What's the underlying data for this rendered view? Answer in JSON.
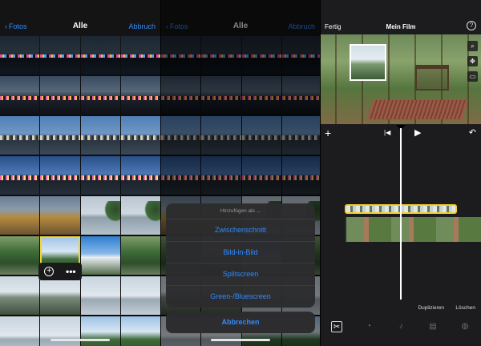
{
  "photos_panel": {
    "back_label": "Fotos",
    "title": "Alle",
    "cancel_label": "Abbruch",
    "rows": [
      [
        "night",
        "night",
        "night",
        "night"
      ],
      [
        "dusk",
        "dusk",
        "dusk",
        "dusk"
      ],
      [
        "blue",
        "blue",
        "blue",
        "blue"
      ],
      [
        "bluelit",
        "bluelit",
        "bluelit",
        "bluelit"
      ],
      [
        "plaza",
        "plaza",
        "lake",
        "lake"
      ],
      [
        "green",
        "skytree",
        "sky",
        "green"
      ],
      [
        "pavilion",
        "pavilion",
        "waterbright",
        "waterbright"
      ],
      [
        "waterbright",
        "waterbright",
        "skytree",
        "skytree"
      ]
    ],
    "selected": {
      "row": 5,
      "col": 1
    }
  },
  "add_panel": {
    "back_label": "Fotos",
    "title": "Alle",
    "cancel_label": "Abbruch",
    "sheet_title": "Hinzufügen als ...",
    "options": [
      "Zwischenschnitt",
      "Bild-in-Bild",
      "Splitscreen",
      "Green-/Bluescreen"
    ],
    "abort_label": "Abbrechen"
  },
  "editor_panel": {
    "done_label": "Fertig",
    "title": "Mein Film",
    "help_icon": "?",
    "duplicate_label": "Duplizieren",
    "delete_label": "Löschen",
    "accent_color": "#f6cf2c"
  },
  "colors": {
    "link": "#2f8cff",
    "clip_border": "#f6cf2c"
  }
}
